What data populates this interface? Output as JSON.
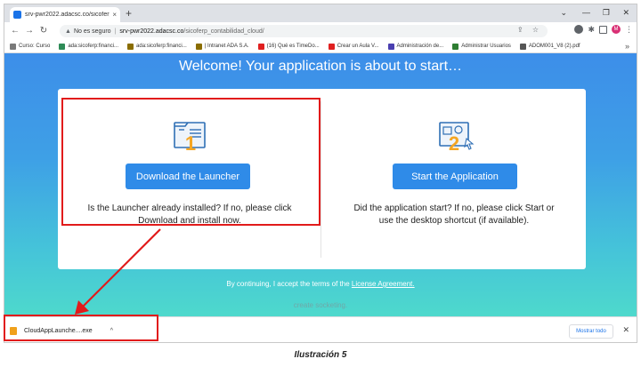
{
  "browser": {
    "tab_title": "srv-pwr2022.adacsc.co/sicoferp_",
    "tab_close": "×",
    "new_tab": "+",
    "window_controls": {
      "minimize": "⌄",
      "min2": "—",
      "restore": "❐",
      "close": "✕"
    },
    "nav": {
      "back": "←",
      "forward": "→",
      "reload": "↻"
    },
    "address": {
      "security": "No es seguro",
      "url_host": "srv-pwr2022.adacsc.co",
      "url_path": "/sicoferp_contabilidad_cloud/",
      "right_icons": "⇪ ☆"
    },
    "profile_initial": "M",
    "bookmarks": [
      {
        "label": "Curso: Curso",
        "color": "#7a7a7a"
      },
      {
        "label": "ada:sicoferp:financi...",
        "color": "#2e8b57"
      },
      {
        "label": "ada:sicoferp:financi...",
        "color": "#8a6d00"
      },
      {
        "label": "| Intranet ADA S.A.",
        "color": "#8a6d00"
      },
      {
        "label": "(16) Qué es TimeDo...",
        "color": "#e02020"
      },
      {
        "label": "Crear un Aula V...",
        "color": "#e02020"
      },
      {
        "label": "Administración de...",
        "color": "#4a3fb0"
      },
      {
        "label": "Administrar Usuarios",
        "color": "#2e7d32"
      },
      {
        "label": "ADOM001_V8 (2).pdf",
        "color": "#555555"
      }
    ],
    "bookmarks_more": "»"
  },
  "page": {
    "title": "Welcome! Your application is about to start…",
    "step1": {
      "number": "1",
      "button": "Download the Launcher",
      "description_line1": "Is the Launcher already installed? If no, please click",
      "description_line2": "Download and install now."
    },
    "step2": {
      "number": "2",
      "button": "Start the Application",
      "description_line1": "Did the application start? If no, please click Start or",
      "description_line2": "use the desktop shortcut (if available)."
    },
    "consent_prefix": "By continuing, I accept the terms of the ",
    "consent_link": "License Agreement.",
    "status": "create socketing."
  },
  "shelf": {
    "file_name": "CloudAppLaunche....exe",
    "chevron": "^",
    "show_all": "Mostrar todo",
    "close": "✕"
  },
  "caption": "Ilustración 5",
  "colors": {
    "accent_button": "#2f8be8",
    "icon_orange": "#f5a623",
    "icon_blue": "#2f6fb5",
    "annotation_red": "#e11b1b"
  }
}
